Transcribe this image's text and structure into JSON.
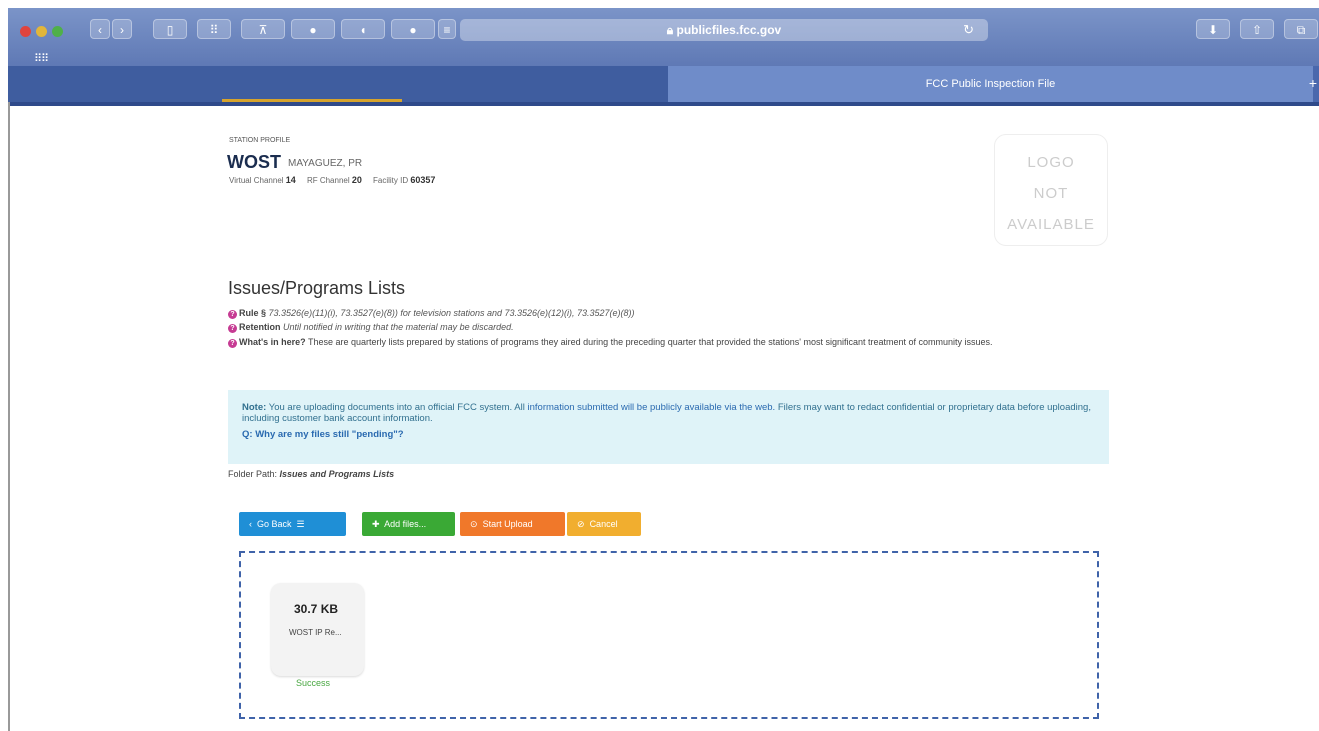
{
  "browser": {
    "url": "publicfiles.fcc.gov",
    "lock_icon": "lock-icon",
    "tab_title": "FCC Public Inspection File"
  },
  "station": {
    "section_label": "STATION PROFILE",
    "call_sign": "WOST",
    "location": "MAYAGUEZ, PR",
    "virtual_channel_label": "Virtual Channel",
    "virtual_channel": "14",
    "rf_channel_label": "RF Channel",
    "rf_channel": "20",
    "facility_id_label": "Facility ID",
    "facility_id": "60357",
    "logo_text": [
      "LOGO",
      "NOT",
      "AVAILABLE"
    ]
  },
  "page": {
    "title": "Issues/Programs Lists",
    "rule_label": "Rule §",
    "rule_text": "73.3526(e)(11)(i), 73.3527(e)(8)) for television stations and 73.3526(e)(12)(i), 73.3527(e)(8))",
    "retention_label": "Retention",
    "retention_text": "Until notified in writing that the material may be discarded.",
    "whats_label": "What's in here?",
    "whats_text": "These are quarterly lists prepared by stations of programs they aired during the preceding quarter that provided the stations' most significant treatment of community issues."
  },
  "note": {
    "label": "Note:",
    "text_a": "You are uploading documents into an official FCC system. All",
    "text_link": "information submitted will be publicly available via the web.",
    "text_b": "Filers may want to redact confidential or proprietary data before uploading, including customer bank account information.",
    "faq": "Q: Why are my files still \"pending\"?"
  },
  "folder": {
    "label": "Folder Path:",
    "path": "Issues and Programs Lists"
  },
  "buttons": {
    "go_back": "Go Back",
    "add_files": "Add files...",
    "start_upload": "Start Upload",
    "cancel": "Cancel"
  },
  "upload": {
    "file_size": "30.7 KB",
    "file_name": "WOST IP Re...",
    "status": "Success"
  },
  "colors": {
    "go_back": "#1f8fd6",
    "add_files": "#3aa935",
    "start_upload": "#f0782a",
    "cancel": "#f1ae2f",
    "success": "#49a742",
    "note_bg": "#dff3f8"
  }
}
